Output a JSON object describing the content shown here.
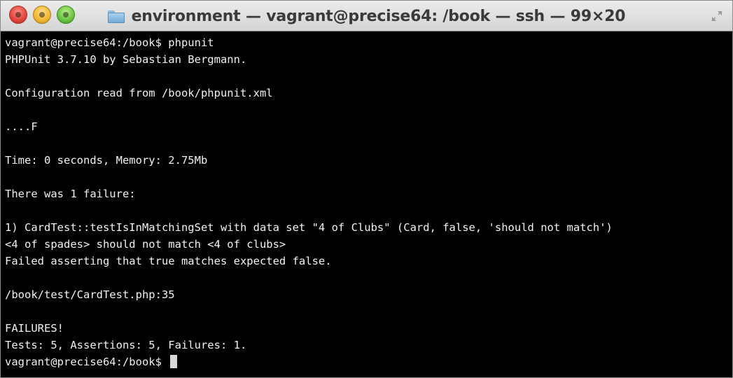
{
  "window": {
    "title": "environment — vagrant@precise64: /book — ssh — 99×20"
  },
  "icons": {
    "close": "close-icon",
    "minimize": "minimize-icon",
    "maximize": "zoom-icon",
    "folder": "folder-icon",
    "resize": "fullscreen-icon"
  },
  "colors": {
    "background": "#000000",
    "foreground": "#f2f2f2",
    "titlebar": "#dcdcdc"
  },
  "terminal": {
    "lines": [
      "vagrant@precise64:/book$ phpunit",
      "PHPUnit 3.7.10 by Sebastian Bergmann.",
      "",
      "Configuration read from /book/phpunit.xml",
      "",
      "....F",
      "",
      "Time: 0 seconds, Memory: 2.75Mb",
      "",
      "There was 1 failure:",
      "",
      "1) CardTest::testIsInMatchingSet with data set \"4 of Clubs\" (Card, false, 'should not match')",
      "<4 of spades> should not match <4 of clubs>",
      "Failed asserting that true matches expected false.",
      "",
      "/book/test/CardTest.php:35",
      "",
      "FAILURES!",
      "Tests: 5, Assertions: 5, Failures: 1."
    ],
    "prompt": "vagrant@precise64:/book$ "
  }
}
